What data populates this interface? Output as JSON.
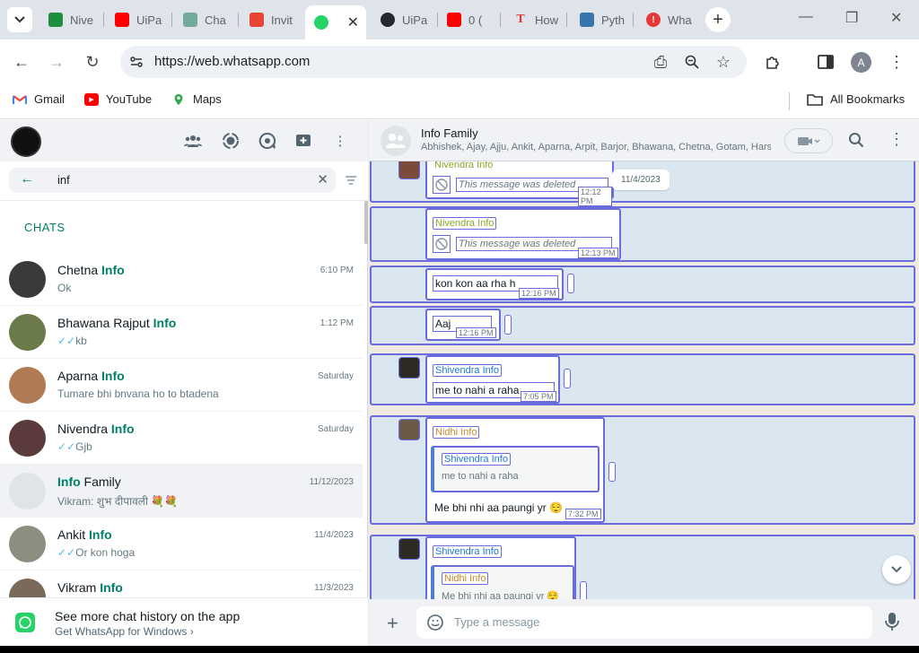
{
  "browser": {
    "tabs": [
      {
        "label": "Nive",
        "color": "#1e8e3e"
      },
      {
        "label": "UiPa",
        "color": "#ff0000"
      },
      {
        "label": "Cha",
        "color": "#74aa9c"
      },
      {
        "label": "Invit",
        "color": "#ea4335"
      },
      {
        "label": "",
        "color": "#25d366"
      },
      {
        "label": "UiPa",
        "color": "#24292f"
      },
      {
        "label": "0 (",
        "color": "#ff0000"
      },
      {
        "label": "How",
        "color": "#e53935"
      },
      {
        "label": "Pyth",
        "color": "#3776ab"
      },
      {
        "label": "Wha",
        "color": "#e53935"
      }
    ],
    "url": "https://web.whatsapp.com",
    "profile_letter": "A",
    "bookmarks": [
      {
        "label": "Gmail",
        "color": "#ea4335"
      },
      {
        "label": "YouTube",
        "color": "#ff0000"
      },
      {
        "label": "Maps",
        "color": "#34a853"
      }
    ],
    "all_bookmarks": "All Bookmarks"
  },
  "sidebar": {
    "search_value": "inf",
    "chats_label": "CHATS",
    "chats": [
      {
        "name": "Chetna ",
        "match": "Info",
        "time": "6:10 PM",
        "preview": "Ok",
        "ticks": "",
        "avatar_color": "#3a3a3a"
      },
      {
        "name": "Bhawana Rajput ",
        "match": "Info",
        "time": "1:12 PM",
        "preview": "kb",
        "ticks": "✓✓",
        "avatar_color": "#6b7a4a"
      },
      {
        "name": "Aparna ",
        "match": "Info",
        "time": "Saturday",
        "preview": "Tumare bhi bnvana ho to btadena",
        "ticks": "",
        "avatar_color": "#b07a55"
      },
      {
        "name": "Nivendra ",
        "match": "Info",
        "time": "Saturday",
        "preview": "Gjb",
        "ticks": "✓✓",
        "avatar_color": "#5a3a3a"
      },
      {
        "name": " Family",
        "match": "Info",
        "time": "11/12/2023",
        "preview": "Vikram: शुभ दीपावली 💐💐",
        "ticks": "",
        "avatar_color": "#dfe5e7",
        "match_first": true
      },
      {
        "name": "Ankit ",
        "match": "Info",
        "time": "11/4/2023",
        "preview": "Or kon hoga",
        "ticks": "✓✓",
        "avatar_color": "#8a8f80"
      },
      {
        "name": "Vikram ",
        "match": "Info",
        "time": "11/3/2023",
        "preview": "",
        "ticks": "",
        "avatar_color": "#7a6a5a"
      }
    ],
    "footer": {
      "title": "See more chat history on the app",
      "subtitle": "Get WhatsApp for Windows ›"
    }
  },
  "conversation": {
    "group_name": "Info Family",
    "members": "Abhishek, Ajay, Ajju, Ankit, Aparna, Arpit, Barjor, Bhawana, Chetna, Gotam, Hars...",
    "date_pill": "11/4/2023",
    "messages": {
      "m1": {
        "sender": "Nivendra Info",
        "text": "This message was deleted",
        "time": "12:12 PM"
      },
      "m2": {
        "sender": "Nivendra Info",
        "text": "This message was deleted",
        "time": "12:13 PM"
      },
      "m3": {
        "text": "kon kon aa rha h",
        "time": "12:16 PM"
      },
      "m4": {
        "text": "Aaj",
        "time": "12:16 PM"
      },
      "m5": {
        "sender": "Shivendra Info",
        "text": "me to nahi a raha",
        "time": "7:05 PM"
      },
      "m6": {
        "sender": "Nidhi Info",
        "quote_sender": "Shivendra Info",
        "quote_text": "me to nahi a raha",
        "text": "Me bhi nhi aa paungi yr 😌",
        "time": "7:32 PM"
      },
      "m7": {
        "sender": "Shivendra Info",
        "quote_sender": "Nidhi Info",
        "quote_text": "Me bhi nhi aa paungi yr 😌"
      }
    },
    "composer_placeholder": "Type a message"
  },
  "colors": {
    "accent": "#008069",
    "outline": "#6a6bdc",
    "row_bg": "#dae7f1",
    "nivendra": "#8ba72c",
    "shivendra": "#1f75d6",
    "nidhi": "#c9882b"
  }
}
